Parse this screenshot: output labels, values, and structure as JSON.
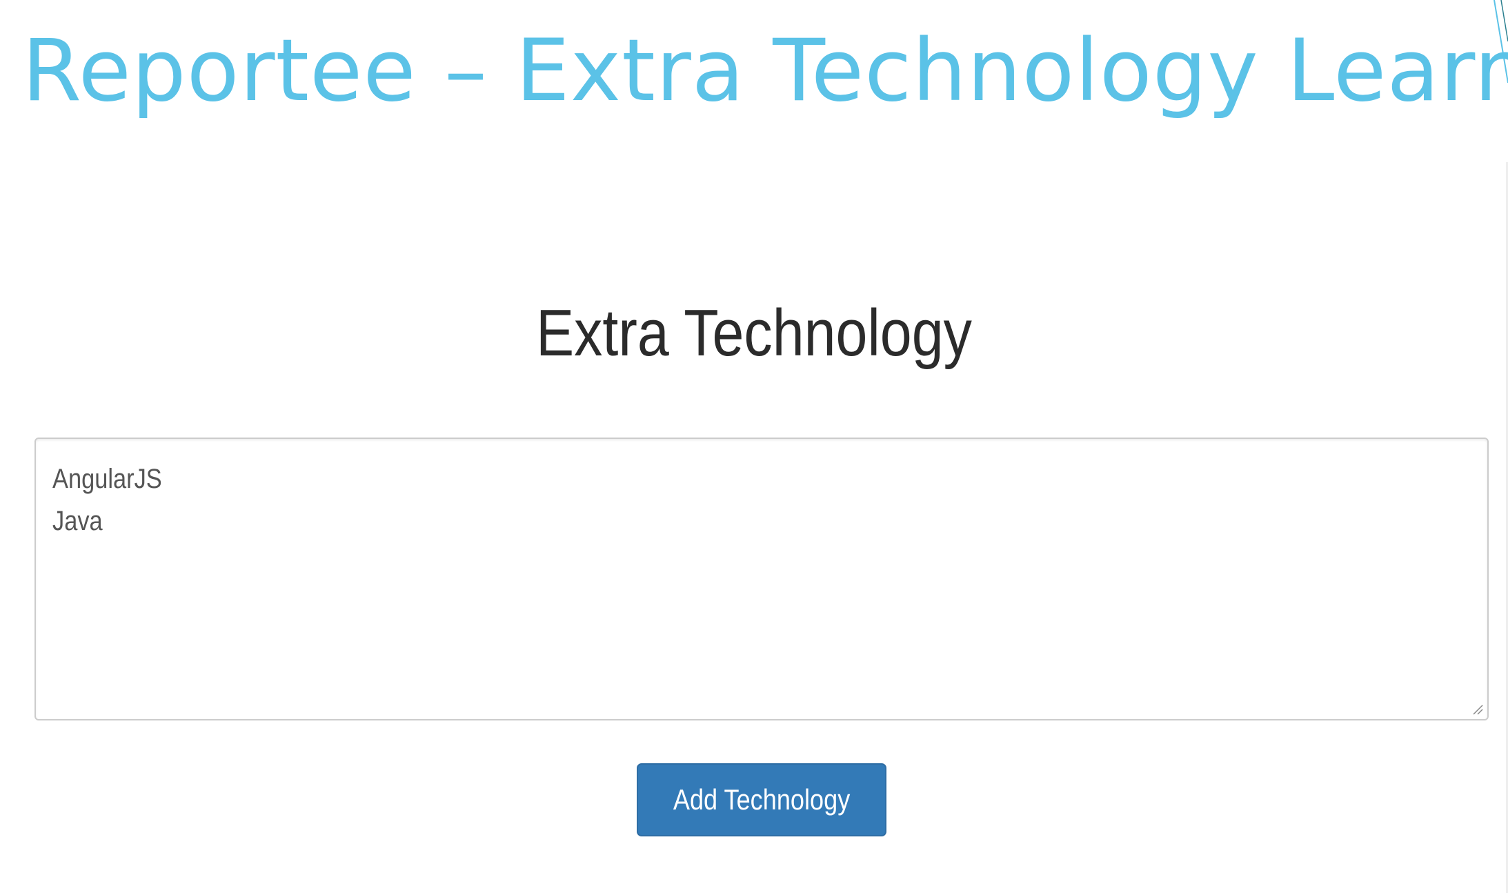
{
  "slide": {
    "title": "Reportee – Extra Technology Learnt"
  },
  "panel": {
    "heading": "Extra Technology",
    "textarea": {
      "lines": [
        "AngularJS",
        "Java"
      ]
    },
    "add_button_label": "Add Technology"
  },
  "colors": {
    "title": "#5bc2e7",
    "button": "#337ab7",
    "heading": "#2b2b2b"
  },
  "icons": [
    "resize-handle-icon"
  ]
}
